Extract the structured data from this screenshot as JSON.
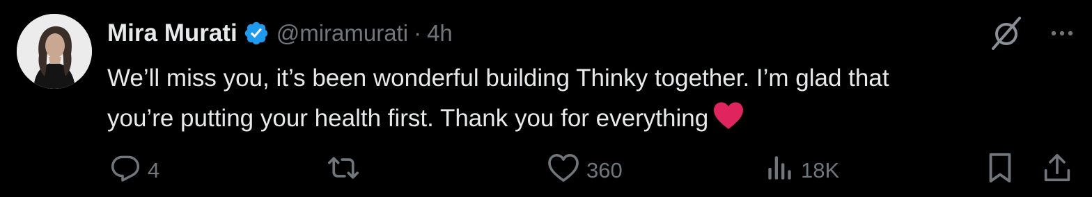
{
  "author": {
    "name": "Mira Murati",
    "handle": "@miramurati",
    "separator": "·",
    "time": "4h",
    "verified": true
  },
  "tweet": {
    "line1": "We’ll miss you, it’s been wonderful building Thinky together. I’m glad that",
    "line2": "you’re putting your health first. Thank you for everything",
    "emoji": "red-heart"
  },
  "actions": {
    "replies": "4",
    "retweets": "",
    "likes": "360",
    "views": "18K"
  },
  "icons": {
    "grok": "grok-icon",
    "more": "more-icon",
    "reply": "reply-icon",
    "retweet": "retweet-icon",
    "like": "heart-icon",
    "views": "views-icon",
    "bookmark": "bookmark-icon",
    "share": "share-icon"
  },
  "colors": {
    "background": "#000000",
    "text": "#e7e9ea",
    "muted": "#71767b",
    "verified": "#1d9bf0",
    "heart_emoji": "#e0245e"
  }
}
